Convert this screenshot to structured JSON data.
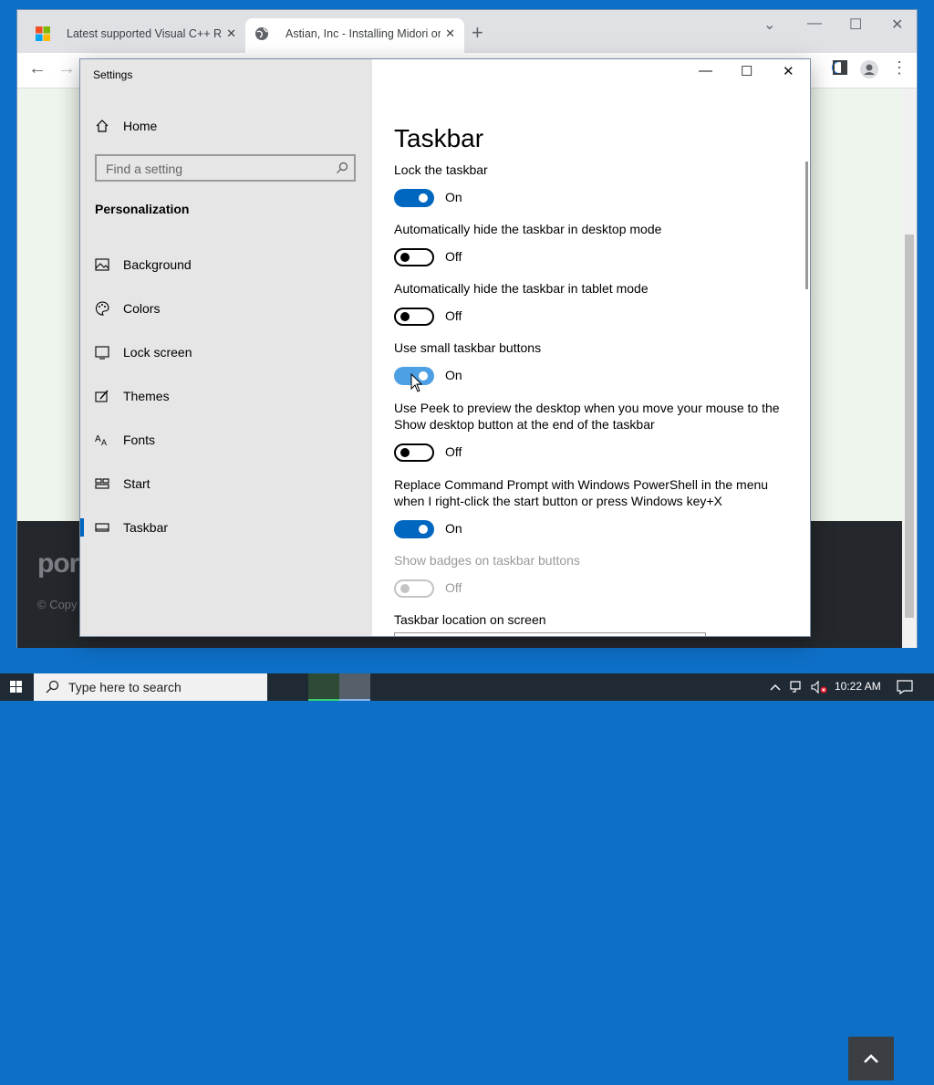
{
  "browser": {
    "tabs": [
      {
        "label": "Latest supported Visual C++ Redi"
      },
      {
        "label": "Astian, Inc - Installing Midori on"
      }
    ],
    "page": {
      "footer_logo": "por",
      "footer_copy": "© Copy"
    }
  },
  "settings": {
    "window_title": "Settings",
    "home_label": "Home",
    "search_placeholder": "Find a setting",
    "group_heading": "Personalization",
    "nav_items": [
      {
        "label": "Background",
        "icon": "image-icon"
      },
      {
        "label": "Colors",
        "icon": "palette-icon"
      },
      {
        "label": "Lock screen",
        "icon": "lock-screen-icon"
      },
      {
        "label": "Themes",
        "icon": "themes-icon"
      },
      {
        "label": "Fonts",
        "icon": "fonts-icon"
      },
      {
        "label": "Start",
        "icon": "start-icon"
      },
      {
        "label": "Taskbar",
        "icon": "taskbar-icon",
        "selected": true
      }
    ],
    "page_title": "Taskbar",
    "options": [
      {
        "label": "Lock the taskbar",
        "state": "On"
      },
      {
        "label": "Automatically hide the taskbar in desktop mode",
        "state": "Off"
      },
      {
        "label": "Automatically hide the taskbar in tablet mode",
        "state": "Off"
      },
      {
        "label": "Use small taskbar buttons",
        "state": "On"
      },
      {
        "label": "Use Peek to preview the desktop when you move your mouse to the Show desktop button at the end of the taskbar",
        "state": "Off"
      },
      {
        "label": "Replace Command Prompt with Windows PowerShell in the menu when I right-click the start button or press Windows key+X",
        "state": "On"
      },
      {
        "label": "Show badges on taskbar buttons",
        "state": "Off",
        "disabled": true
      }
    ],
    "location_label": "Taskbar location on screen"
  },
  "taskbar": {
    "search_placeholder": "Type here to search",
    "time": "10:22 AM"
  },
  "colors": {
    "accent": "#0067c0",
    "toggle_hover": "#4ea0e5",
    "desktop": "#0e6fc7"
  }
}
